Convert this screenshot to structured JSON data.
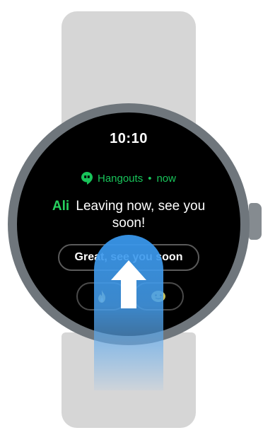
{
  "watch": {
    "time": "10:10"
  },
  "notification": {
    "app_name": "Hangouts",
    "separator": "•",
    "timestamp": "now",
    "sender": "Ali",
    "message": "Leaving now, see you soon!"
  },
  "quick_replies": {
    "text_reply": "Great, see you soon",
    "emoji_1_icon": "fire-emoji-icon",
    "emoji_2_icon": "smiley-emoji-icon"
  },
  "gesture": {
    "icon": "swipe-up-arrow-icon",
    "color": "#3a96eb"
  },
  "colors": {
    "accent_green": "#18c45a",
    "screen": "#000000",
    "bezel": "#6f767c",
    "band": "#d6d6d6"
  }
}
